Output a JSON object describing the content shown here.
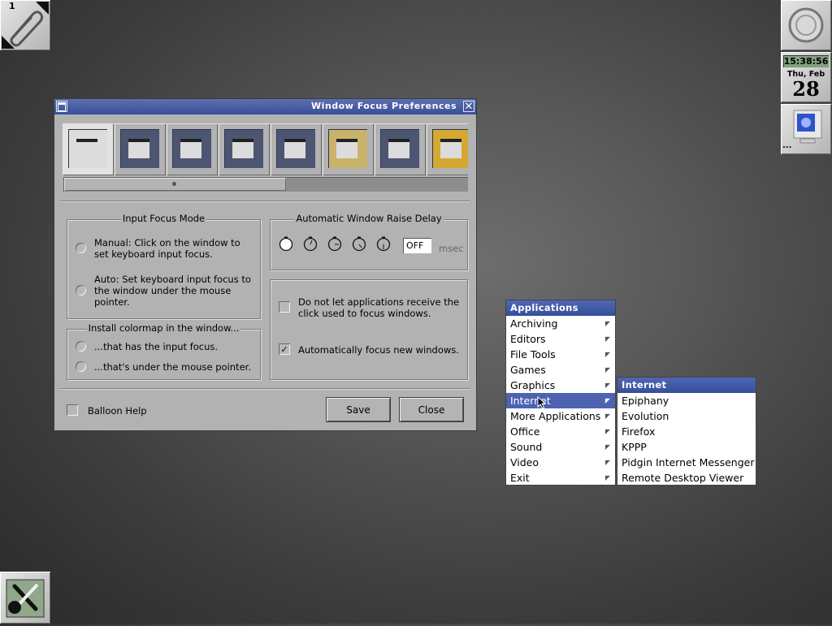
{
  "desktop": {
    "pager_label": "1",
    "clock": {
      "time": "15:38:56",
      "day": "Thu, Feb",
      "date": "28"
    },
    "more_indicator": "..."
  },
  "window": {
    "title": "Window Focus Preferences",
    "toolbar_icons": [
      "focus-prefs-icon",
      "move-prefs-icon",
      "placement-prefs-icon",
      "misc-prefs-icon",
      "menu-prefs-icon",
      "desktop-prefs-icon",
      "panel-prefs-icon",
      "theme-prefs-icon"
    ],
    "input_focus": {
      "group_label": "Input Focus Mode",
      "manual": "Manual:  Click on the window to set keyboard input focus.",
      "auto": "Auto:  Set keyboard input focus to the window under the mouse pointer."
    },
    "raise_delay": {
      "group_label": "Automatic Window Raise Delay",
      "value": "OFF",
      "unit": "msec"
    },
    "colormap": {
      "group_label": "Install colormap in the window...",
      "opt1": "...that has the input focus.",
      "opt2": "...that's under the mouse pointer."
    },
    "options": {
      "no_click": "Do not let applications receive the click used to focus windows.",
      "auto_focus": "Automatically focus new windows.",
      "auto_focus_checked": true
    },
    "balloon_help": "Balloon Help",
    "save": "Save",
    "close": "Close"
  },
  "menu": {
    "title": "Applications",
    "items": [
      "Archiving",
      "Editors",
      "File Tools",
      "Games",
      "Graphics",
      "Internet",
      "More Applications",
      "Office",
      "Sound",
      "Video",
      "Exit"
    ],
    "highlighted": "Internet"
  },
  "submenu": {
    "title": "Internet",
    "items": [
      "Epiphany",
      "Evolution",
      "Firefox",
      "KPPP",
      "Pidgin Internet Messenger",
      "Remote Desktop Viewer"
    ]
  }
}
